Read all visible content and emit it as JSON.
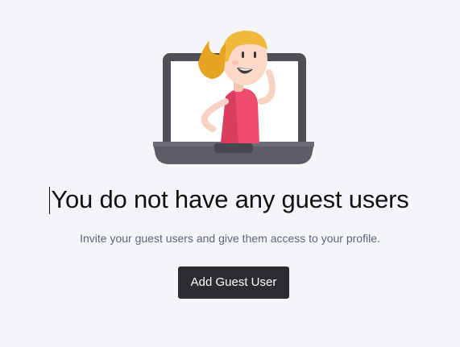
{
  "empty_state": {
    "illustration": "laptop-with-waving-person-illustration",
    "heading": "You do not have any guest users",
    "subtext": "Invite your guest users and give them access to your profile.",
    "add_button_label": "Add Guest User"
  },
  "colors": {
    "background": "#f4f5f9",
    "button": "#2b2b30",
    "heading": "#111111",
    "subtext": "#5f6477"
  }
}
